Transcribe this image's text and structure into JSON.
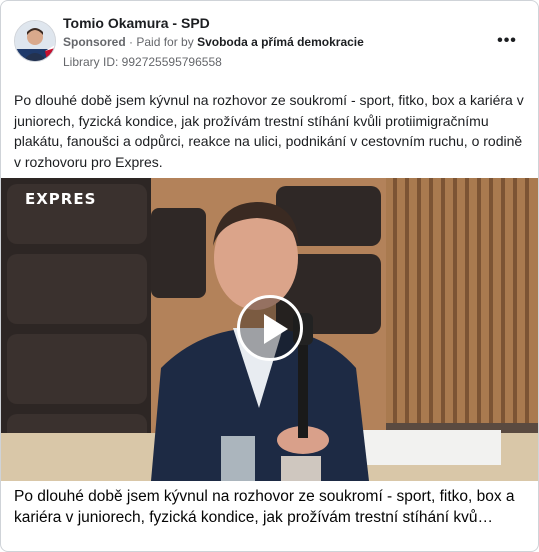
{
  "post": {
    "page_name": "Tomio Okamura - SPD",
    "sponsored_label": "Sponsored",
    "paid_for_prefix": "Paid for by",
    "funder": "Svoboda a přímá demokracie",
    "library_id": "Library ID: 992725595796558",
    "more_options_icon": "more-horizontal-icon",
    "body_text": "Po dlouhé době jsem kývnul na rozhovor ze soukromí - sport, fitko, box a kariéra v juniorech, fyzická kondice, jak prožívám trestní stíhání kvůli protiimigračnímu plakátu, fanoušci a odpůrci, reakce na ulici, podnikání v cestovním ruchu, o rodině v rozhovoru pro Expres."
  },
  "video": {
    "overlay_logo_text": "EXPRES",
    "play_icon": "play-icon"
  },
  "caption": {
    "text": "Po dlouhé době jsem kývnul na rozhovor ze soukromí - sport, fitko, box a kariéra v juniorech, fyzická kondice, jak prožívám trestní stíhání kvů…"
  }
}
